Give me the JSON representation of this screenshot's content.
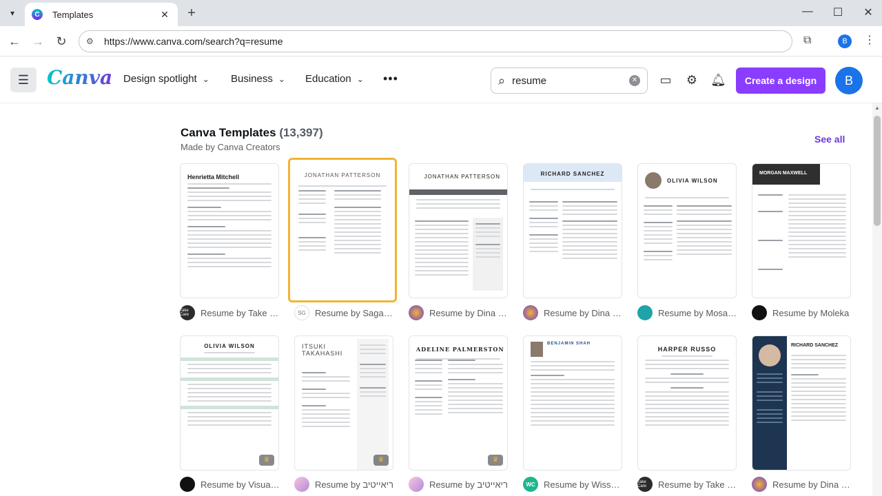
{
  "browser": {
    "tab_title": "Templates",
    "url": "https://www.canva.com/search?q=resume",
    "profile_initial": "B"
  },
  "header": {
    "logo": "Canva",
    "nav": [
      {
        "label": "Design spotlight"
      },
      {
        "label": "Business"
      },
      {
        "label": "Education"
      }
    ],
    "search_value": "resume",
    "create_label": "Create a design",
    "avatar_initial": "B"
  },
  "section": {
    "title": "Canva Templates",
    "count": "(13,397)",
    "subtitle": "Made by Canva Creators",
    "see_all": "See all"
  },
  "templates_row1": [
    {
      "name": "Henrietta Mitchell",
      "caption": "Resume by Take Ca...",
      "avatar_text": "Take Care",
      "avatar_color": "#2b2b2b"
    },
    {
      "name": "JONATHAN PATTERSON",
      "caption": "Resume by Saga D...",
      "avatar_text": "SG",
      "avatar_color": "#ffffff"
    },
    {
      "name": "JONATHAN PATTERSON",
      "caption": "Resume by Dina So...",
      "avatar_text": "",
      "avatar_color": "#6a3bd9"
    },
    {
      "name": "RICHARD SANCHEZ",
      "caption": "Resume by Dina So...",
      "avatar_text": "",
      "avatar_color": "#6a3bd9"
    },
    {
      "name": "OLIVIA WILSON",
      "caption": "Resume by Mosala...",
      "avatar_text": "",
      "avatar_color": "#1fa3a8"
    },
    {
      "name": "MORGAN MAXWELL",
      "caption": "Resume by Moleka",
      "avatar_text": "",
      "avatar_color": "#111111"
    }
  ],
  "templates_row2": [
    {
      "name": "OLIVIA WILSON",
      "caption": "Resume by Visual ...",
      "avatar_text": "",
      "avatar_color": "#111111"
    },
    {
      "name": "ITSUKI TAKAHASHI",
      "caption": "Resume by ריאייטיב",
      "avatar_text": "",
      "avatar_color": "#b48ad9"
    },
    {
      "name": "ADELINE PALMERSTON",
      "caption": "Resume by ריאייטיב",
      "avatar_text": "",
      "avatar_color": "#b48ad9"
    },
    {
      "name": "BENJAMIN SHAH",
      "caption": "Resume by WissCr...",
      "avatar_text": "WC",
      "avatar_color": "#1fb58f"
    },
    {
      "name": "HARPER RUSSO",
      "caption": "Resume by Take Ca...",
      "avatar_text": "Take Care",
      "avatar_color": "#2b2b2b"
    },
    {
      "name": "RICHARD SANCHEZ",
      "caption": "Resume by Dina So...",
      "avatar_text": "",
      "avatar_color": "#6a3bd9"
    }
  ]
}
